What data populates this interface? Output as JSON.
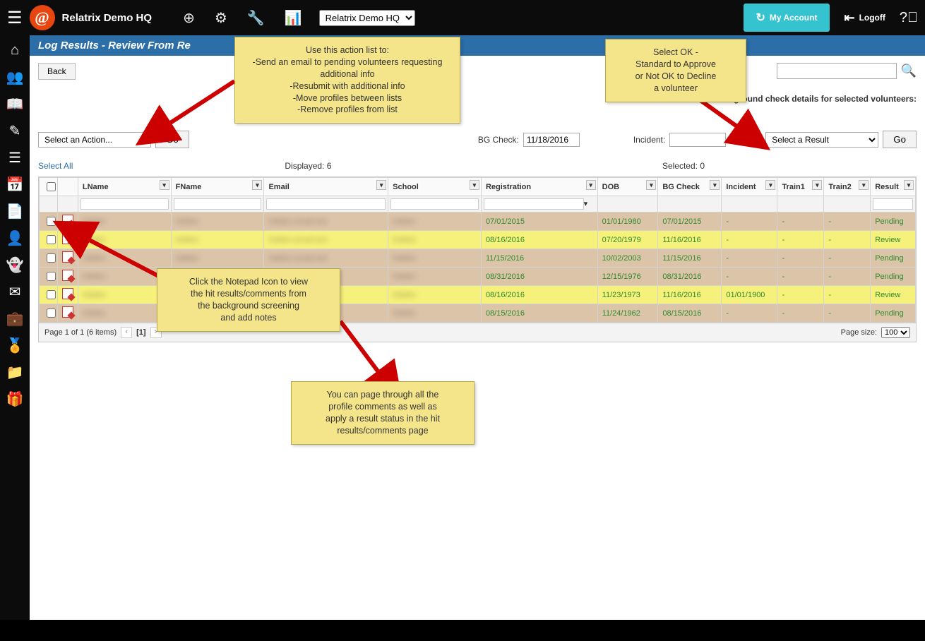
{
  "topbar": {
    "brand": "Relatrix Demo HQ",
    "context_select": "Relatrix Demo HQ",
    "my_account": "My Account",
    "logoff": "Logoff"
  },
  "page": {
    "title": "Log Results - Review From Re",
    "back": "Back",
    "action_select": "Select an Action...",
    "go": "Go",
    "bg_check_label": "BG Check:",
    "bg_check_value": "11/18/2016",
    "incident_label": "Incident:",
    "incident_value": "",
    "detail_header": "Enter background check details for selected volunteers:",
    "result_select": "Select a Result",
    "select_all": "Select All",
    "displayed_label": "Displayed: 6",
    "selected_label": "Selected: 0"
  },
  "table": {
    "headers": {
      "lname": "LName",
      "fname": "FName",
      "email": "Email",
      "school": "School",
      "registration": "Registration",
      "dob": "DOB",
      "bgcheck": "BG Check",
      "incident": "Incident",
      "train1": "Train1",
      "train2": "Train2",
      "result": "Result"
    },
    "rows": [
      {
        "cls": "tan",
        "reg": "07/01/2015",
        "dob": "01/01/1980",
        "bg": "07/01/2015",
        "inc": "-",
        "t1": "-",
        "t2": "-",
        "res": "Pending"
      },
      {
        "cls": "yellow",
        "reg": "08/16/2016",
        "dob": "07/20/1979",
        "bg": "11/16/2016",
        "inc": "-",
        "t1": "-",
        "t2": "-",
        "res": "Review"
      },
      {
        "cls": "tan",
        "reg": "11/15/2016",
        "dob": "10/02/2003",
        "bg": "11/15/2016",
        "inc": "-",
        "t1": "-",
        "t2": "-",
        "res": "Pending"
      },
      {
        "cls": "tan",
        "reg": "08/31/2016",
        "dob": "12/15/1976",
        "bg": "08/31/2016",
        "inc": "-",
        "t1": "-",
        "t2": "-",
        "res": "Pending"
      },
      {
        "cls": "yellow",
        "reg": "08/16/2016",
        "dob": "11/23/1973",
        "bg": "11/16/2016",
        "inc": "01/01/1900",
        "t1": "-",
        "t2": "-",
        "res": "Review"
      },
      {
        "cls": "tan",
        "reg": "08/15/2016",
        "dob": "11/24/1962",
        "bg": "08/15/2016",
        "inc": "-",
        "t1": "-",
        "t2": "-",
        "res": "Pending"
      }
    ]
  },
  "pager": {
    "summary": "Page 1 of 1 (6 items)",
    "current": "[1]",
    "size_label": "Page size:",
    "size_value": "100"
  },
  "callouts": {
    "c1_l1": "Use this action list to:",
    "c1_l2": "-Send an email to pending volunteers requesting additional info",
    "c1_l3": "-Resubmit with additional info",
    "c1_l4": "-Move profiles between lists",
    "c1_l5": "-Remove profiles from list",
    "c2_l1": "Select OK -",
    "c2_l2": "Standard to Approve",
    "c2_l3": "or Not OK to Decline",
    "c2_l4": "a volunteer",
    "c3_l1": "Click the Notepad Icon to view",
    "c3_l2": "the hit results/comments from",
    "c3_l3": "the background screening",
    "c3_l4": "and add notes",
    "c4_l1": "You can page through all the",
    "c4_l2": "profile comments as well as",
    "c4_l3": "apply a result status in the hit",
    "c4_l4": "results/comments page"
  }
}
